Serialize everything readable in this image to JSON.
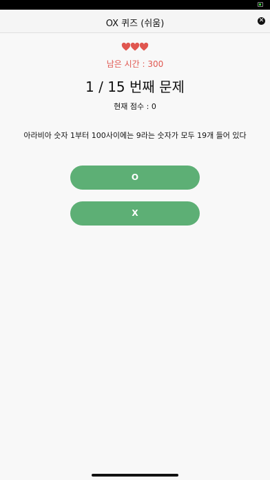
{
  "window": {
    "title": "OX 퀴즈 (쉬움)",
    "close_glyph": "✕"
  },
  "lives": {
    "count": 3,
    "icon": "heart-icon",
    "color": "#e0564f"
  },
  "timer": {
    "label": "남은 시간 : 300"
  },
  "question": {
    "number_label": "1 / 15 번째 문제",
    "text": "아라비아 숫자 1부터 100사이에는 9라는 숫자가 모두 19개 들어 있다"
  },
  "score": {
    "label": "현재 점수 : 0"
  },
  "answers": {
    "o_label": "O",
    "x_label": "X",
    "color": "#5daf75"
  }
}
